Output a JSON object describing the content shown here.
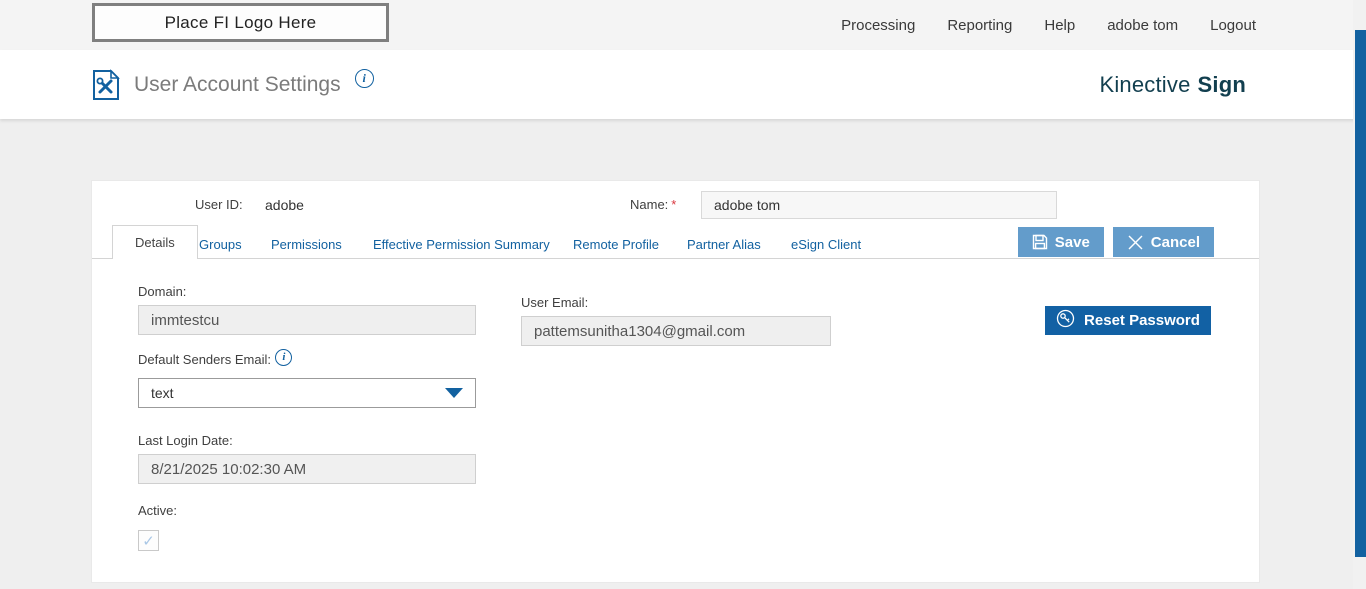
{
  "topbar": {
    "logo_placeholder": "Place FI Logo Here",
    "nav": [
      "Processing",
      "Reporting",
      "Help",
      "adobe tom",
      "Logout"
    ]
  },
  "header": {
    "title": "User Account Settings",
    "brand_name": "Kinective",
    "brand_product": "Sign"
  },
  "panel": {
    "user_id": {
      "label": "User ID:",
      "value": "adobe"
    },
    "name": {
      "label": "Name:",
      "required_mark": "*",
      "value": "adobe tom"
    },
    "tabs": [
      {
        "label": "Details",
        "active": true
      },
      {
        "label": "Groups",
        "active": false
      },
      {
        "label": "Permissions",
        "active": false
      },
      {
        "label": "Effective Permission Summary",
        "active": false
      },
      {
        "label": "Remote Profile",
        "active": false
      },
      {
        "label": "Partner Alias",
        "active": false
      },
      {
        "label": "eSign Client",
        "active": false
      }
    ],
    "actions": {
      "save": "Save",
      "cancel": "Cancel",
      "reset_password": "Reset Password"
    },
    "fields": {
      "domain": {
        "label": "Domain:",
        "value": "immtestcu"
      },
      "user_email": {
        "label": "User Email:",
        "value": "pattemsunitha1304@gmail.com"
      },
      "default_senders_email": {
        "label": "Default Senders Email:",
        "value": "text"
      },
      "last_login_date": {
        "label": "Last Login Date:",
        "value": "8/21/2025 10:02:30 AM"
      },
      "active": {
        "label": "Active:",
        "checked": true,
        "mark": "✓"
      }
    }
  },
  "colors": {
    "link_blue": "#1261a0",
    "button_blue": "#639ccb",
    "reset_button_blue": "#1261a4",
    "brand_dark_teal": "#123f4f",
    "scrollbar_blue": "#1261a0",
    "required_red": "#d9363e"
  }
}
